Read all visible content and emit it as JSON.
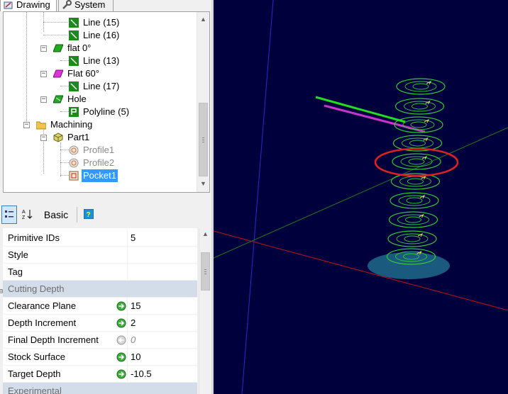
{
  "tabs": {
    "drawing": "Drawing",
    "system": "System"
  },
  "tree": {
    "items": [
      {
        "label": "Line (15)",
        "icon": "line-entity-icon"
      },
      {
        "label": "Line (16)",
        "icon": "line-entity-icon"
      },
      {
        "label": "flat 0°",
        "icon": "layer-green-icon"
      },
      {
        "label": "Line (13)",
        "icon": "line-entity-icon"
      },
      {
        "label": "Flat 60°",
        "icon": "layer-magenta-icon"
      },
      {
        "label": "Line (17)",
        "icon": "line-entity-icon"
      },
      {
        "label": "Hole",
        "icon": "layer-hole-icon"
      },
      {
        "label": "Polyline (5)",
        "icon": "polyline-entity-icon"
      },
      {
        "label": "Machining",
        "icon": "folder-icon"
      },
      {
        "label": "Part1",
        "icon": "part-icon"
      },
      {
        "label": "Profile1",
        "icon": "profile-op-icon"
      },
      {
        "label": "Profile2",
        "icon": "profile-op-icon"
      },
      {
        "label": "Pocket1",
        "icon": "pocket-op-icon"
      }
    ]
  },
  "toolbar": {
    "basic_label": "Basic"
  },
  "properties": {
    "rows": [
      {
        "name": "Primitive IDs",
        "value": "5"
      },
      {
        "name": "Style",
        "value": ""
      },
      {
        "name": "Tag",
        "value": ""
      }
    ],
    "cutting_depth_label": "Cutting Depth",
    "cutting_depth_rows": [
      {
        "name": "Clearance Plane",
        "value": "15"
      },
      {
        "name": "Depth Increment",
        "value": "2"
      },
      {
        "name": "Final Depth Increment",
        "value": "0"
      },
      {
        "name": "Stock Surface",
        "value": "10"
      },
      {
        "name": "Target Depth",
        "value": "-10.5"
      }
    ],
    "experimental_label": "Experimental"
  },
  "colors": {
    "viewport_bg": "#00003d",
    "selection": "#3399ff",
    "toolpath": "#33cc33",
    "highlight_ring": "#dd2222",
    "line_green": "#22dd22",
    "line_magenta": "#cc33cc"
  }
}
